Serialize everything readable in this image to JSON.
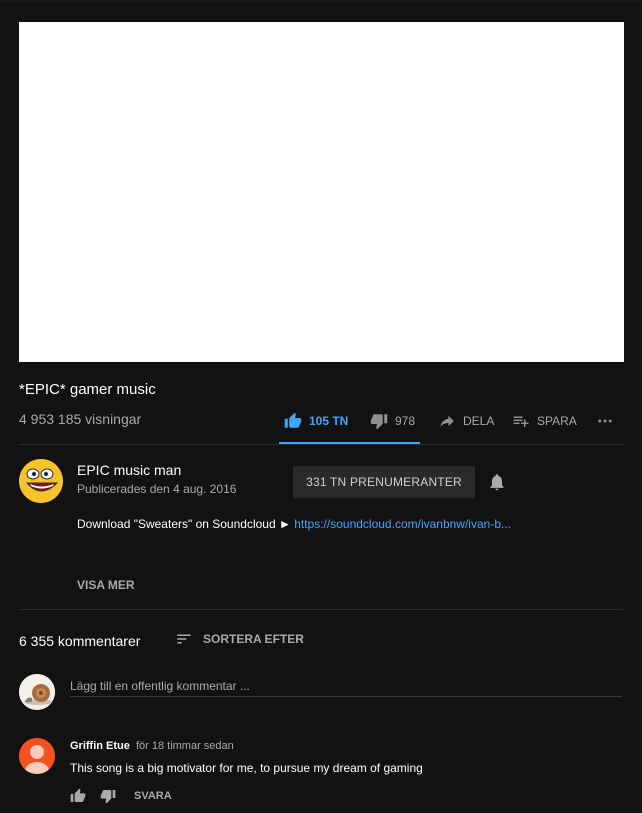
{
  "video": {
    "title": "*EPIC* gamer music",
    "views": "4 953 185 visningar"
  },
  "actions": {
    "like_count": "105 TN",
    "dislike_count": "978",
    "share_label": "DELA",
    "save_label": "SPARA"
  },
  "channel": {
    "name": "EPIC music man",
    "published": "Publicerades den 4 aug. 2016",
    "subscribe_label": "331 TN PRENUMERANTER"
  },
  "description": {
    "text": "Download \"Sweaters\" on Soundcloud ► ",
    "link": "https://soundcloud.com/ivanbnw/ivan-b...",
    "show_more": "VISA MER"
  },
  "comments": {
    "count": "6 355 kommentarer",
    "sort_label": "SORTERA EFTER",
    "add_placeholder": "Lägg till en offentlig kommentar ...",
    "items": [
      {
        "author": "Griffin Etue",
        "time": "för 18 timmar sedan",
        "text": "This song is a big motivator for me, to pursue my dream of gaming",
        "reply_label": "SVARA"
      }
    ]
  },
  "colors": {
    "background": "#121212",
    "accent": "#3ea6ff",
    "secondary_text": "#aaaaaa"
  },
  "icons": [
    "thumb-up-icon",
    "thumb-down-icon",
    "share-icon",
    "playlist-add-icon",
    "more-icon",
    "bell-icon",
    "sort-icon"
  ]
}
